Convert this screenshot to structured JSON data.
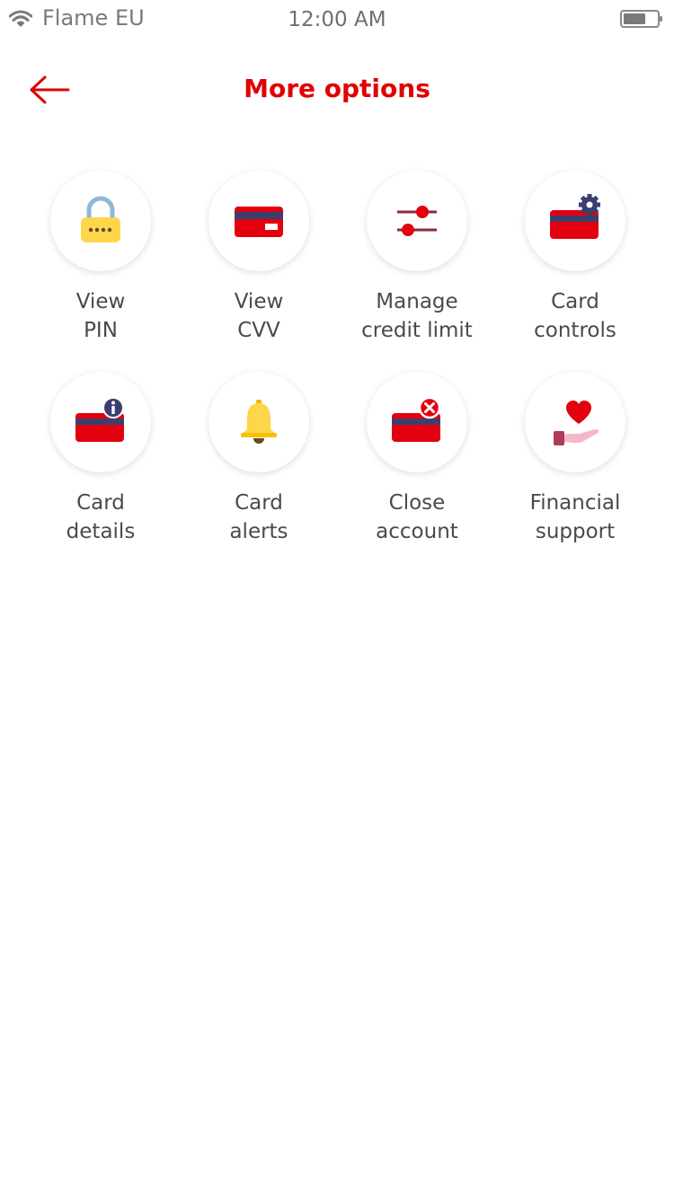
{
  "status_bar": {
    "carrier": "Flame EU",
    "time": "12:00 AM",
    "icons": [
      "wifi-icon",
      "battery-icon"
    ]
  },
  "header": {
    "title": "More options",
    "back_icon": "arrow-left-icon"
  },
  "colors": {
    "brand": "#e00000",
    "text": "#4a4a4a",
    "status_text": "#7a7a7a"
  },
  "options": [
    {
      "line1": "View",
      "line2": "PIN",
      "icon": "padlock-icon"
    },
    {
      "line1": "View",
      "line2": "CVV",
      "icon": "card-cvv-icon"
    },
    {
      "line1": "Manage",
      "line2": "credit limit",
      "icon": "sliders-icon"
    },
    {
      "line1": "Card",
      "line2": "controls",
      "icon": "card-settings-icon"
    },
    {
      "line1": "Card",
      "line2": "details",
      "icon": "card-info-icon"
    },
    {
      "line1": "Card",
      "line2": "alerts",
      "icon": "bell-icon"
    },
    {
      "line1": "Close",
      "line2": "account",
      "icon": "card-close-icon"
    },
    {
      "line1": "Financial",
      "line2": "support",
      "icon": "heart-hand-icon"
    }
  ]
}
